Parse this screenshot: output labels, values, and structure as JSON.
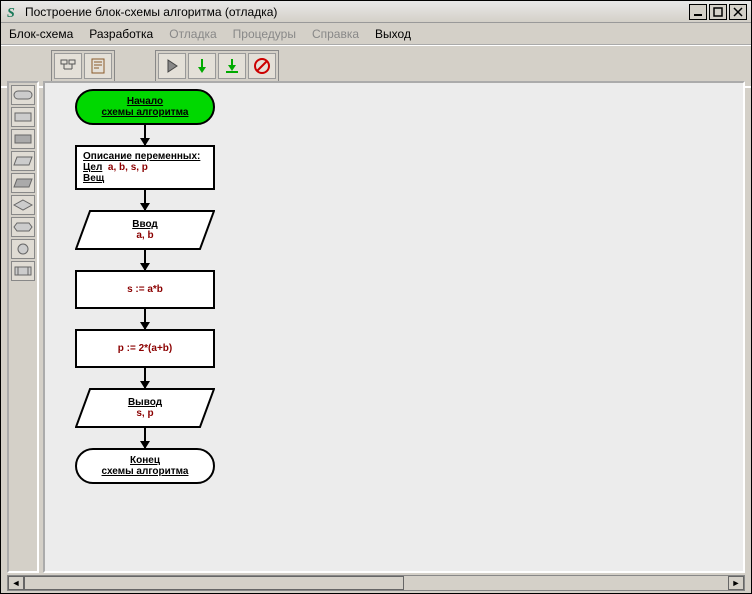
{
  "window": {
    "title": "Построение блок-схемы алгоритма (отладка)"
  },
  "menu": {
    "blockScheme": "Блок-схема",
    "development": "Разработка",
    "debug": "Отладка",
    "procedures": "Процедуры",
    "help": "Справка",
    "exit": "Выход"
  },
  "flow": {
    "start": {
      "line1": "Начало",
      "line2": "схемы алгоритма"
    },
    "vars": {
      "title": "Описание переменных:",
      "intLabel": "Цел",
      "intList": "a, b, s, p",
      "realLabel": "Вещ"
    },
    "input": {
      "title": "Ввод",
      "vars": "a, b"
    },
    "proc1": "s := a*b",
    "proc2": "p := 2*(a+b)",
    "output": {
      "title": "Вывод",
      "vars": "s, p"
    },
    "end": {
      "line1": "Конец",
      "line2": "схемы алгоритма"
    }
  }
}
